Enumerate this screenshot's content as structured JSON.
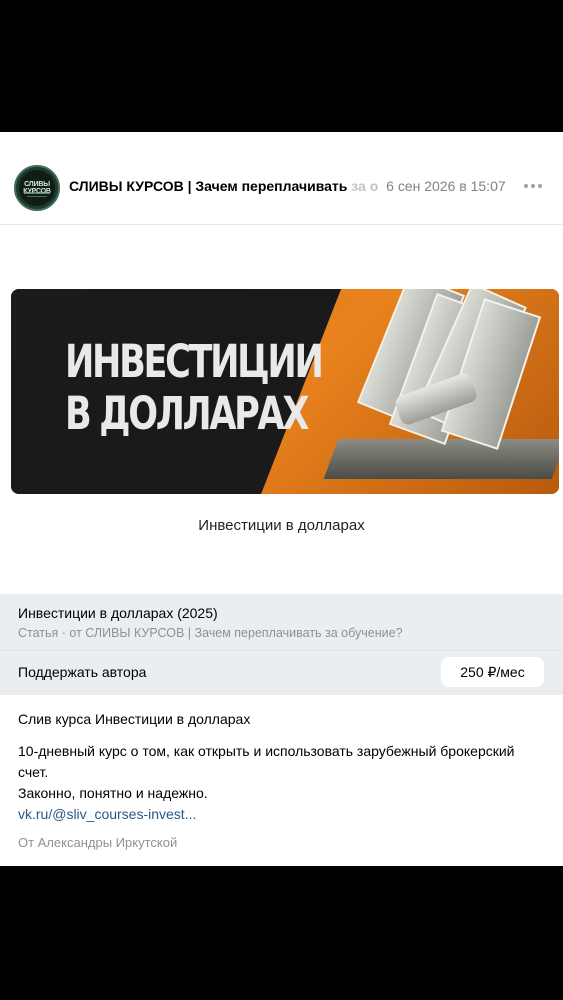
{
  "post": {
    "group_name": "СЛИВЫ КУРСОВ | Зачем переплачивать",
    "group_name_fade": " за о",
    "date": "6 сен 2026 в 15:07",
    "avatar_text": "СЛИВЫ КУРСОВ",
    "menu_icon": "more-dots-icon"
  },
  "banner": {
    "headline_line1": "ИНВЕСТИЦИИ",
    "headline_line2": "В ДОЛЛАРАХ",
    "caption": "Инвестиции в долларах"
  },
  "article": {
    "title": "Инвестиции в долларах (2025)",
    "subtitle": "Статья · от СЛИВЫ КУРСОВ | Зачем переплачивать за обучение?",
    "support_label": "Поддержать автора",
    "price": "250 ₽/мес"
  },
  "description": {
    "line1": "Слив курса Инвестиции в долларах",
    "para1": "10-дневный курс о том, как открыть и использовать зарубежный брокерский счет.",
    "para2": "Законно, понятно и надежно.",
    "link": "vk.ru/@sliv_courses-invest...",
    "author": "От Александры Иркутской"
  },
  "colors": {
    "accent_orange": "#e9831e",
    "link_blue": "#2a5885",
    "panel_gray": "#ebeef0"
  }
}
